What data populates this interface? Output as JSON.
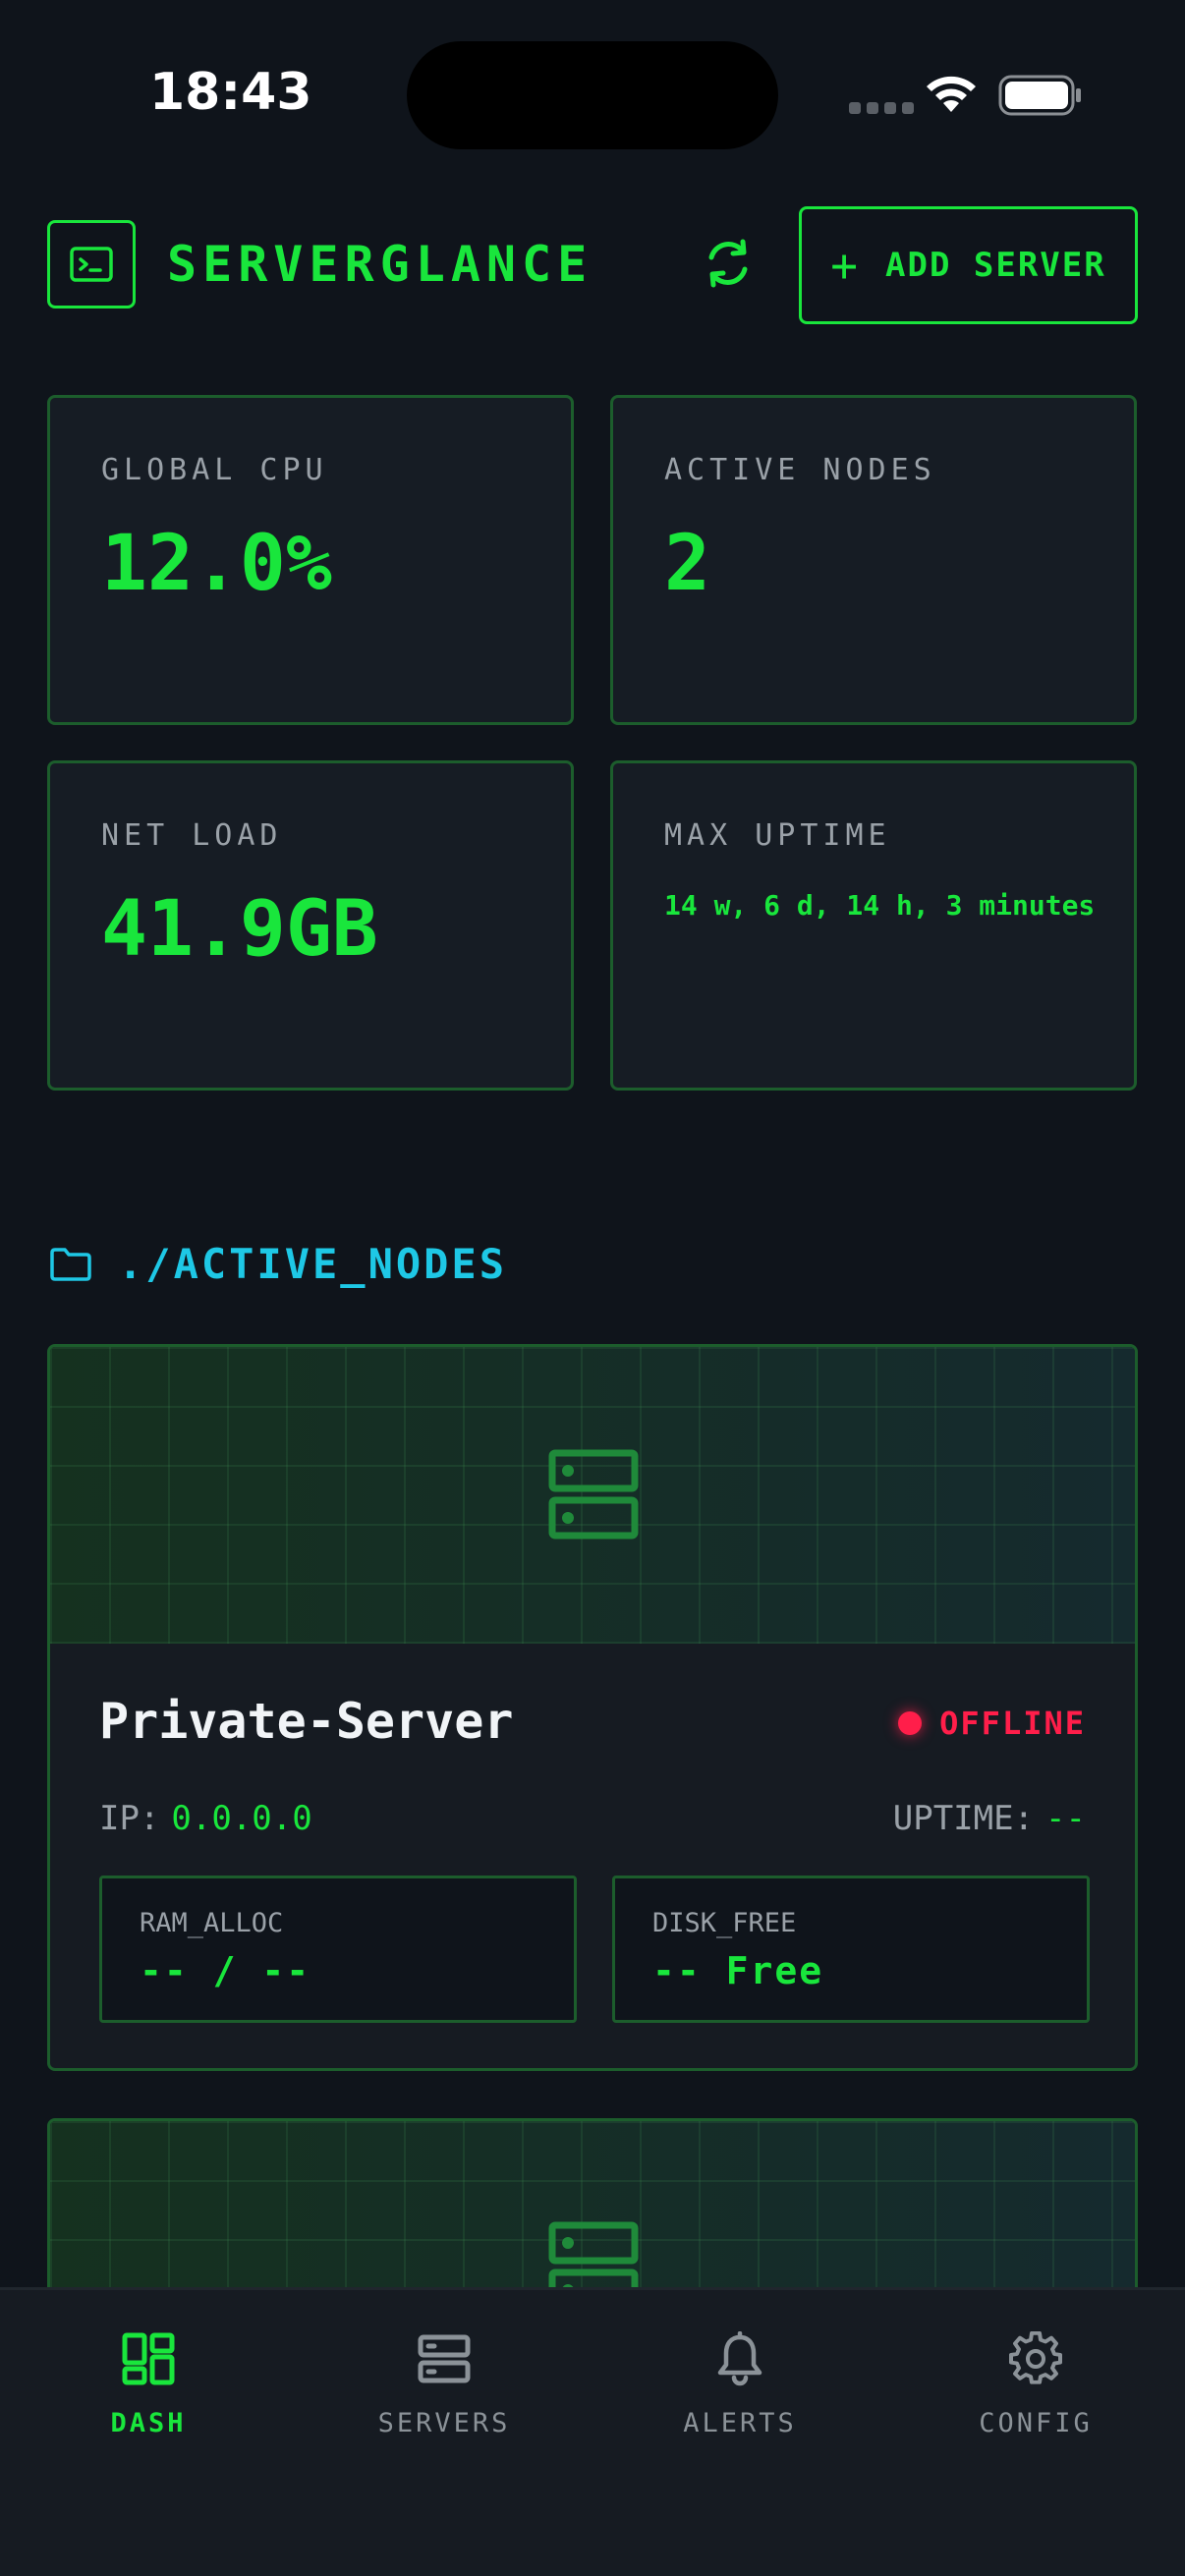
{
  "status_bar": {
    "time": "18:43"
  },
  "header": {
    "brand": "SERVERGLANCE",
    "add_server_label": "ADD SERVER",
    "add_server_plus": "+"
  },
  "stats": [
    {
      "label": "GLOBAL CPU",
      "value": "12.0%"
    },
    {
      "label": "ACTIVE NODES",
      "value": "2"
    },
    {
      "label": "NET LOAD",
      "value": "41.9GB"
    },
    {
      "label": "MAX UPTIME",
      "value": "14 w, 6 d, 14 h, 3 minutes"
    }
  ],
  "section": {
    "title": "./ACTIVE_NODES"
  },
  "servers": [
    {
      "name": "Private-Server",
      "status": "OFFLINE",
      "ip_label": "IP:",
      "ip": "0.0.0.0",
      "uptime_label": "UPTIME:",
      "uptime": "--",
      "ram_label": "RAM_ALLOC",
      "ram_value": "-- / --",
      "disk_label": "DISK_FREE",
      "disk_value": "-- Free"
    }
  ],
  "nav": [
    {
      "label": "DASH",
      "active": true
    },
    {
      "label": "SERVERS",
      "active": false
    },
    {
      "label": "ALERTS",
      "active": false
    },
    {
      "label": "CONFIG",
      "active": false
    }
  ],
  "colors": {
    "accent": "#19e63c",
    "section": "#1ec8e6",
    "offline": "#ff1e4a",
    "background": "#0f141b"
  }
}
